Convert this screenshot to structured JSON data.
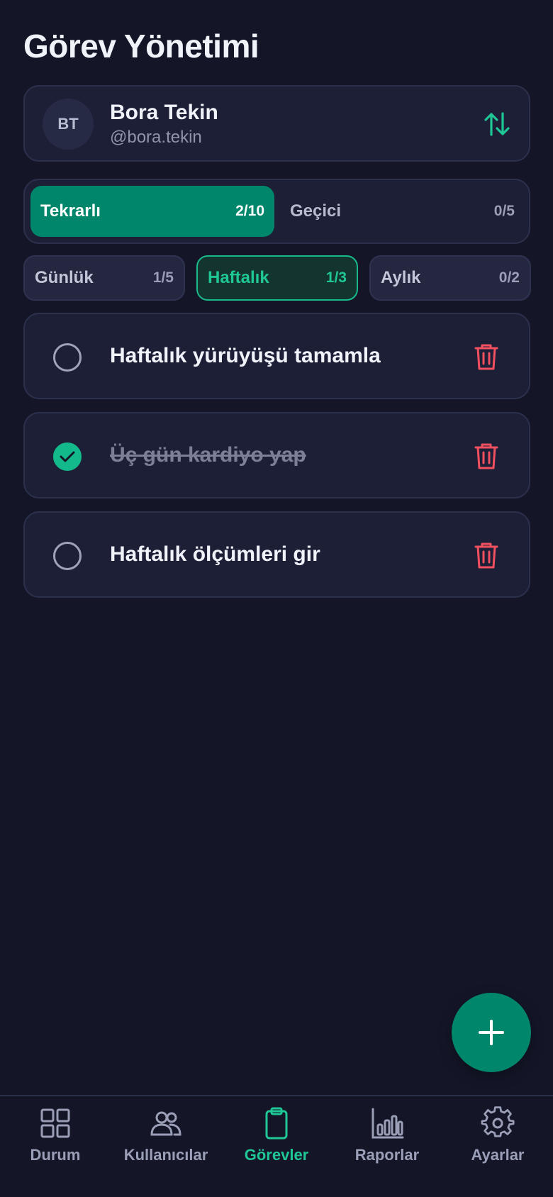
{
  "header": {
    "title": "Görev Yönetimi"
  },
  "user": {
    "initials": "BT",
    "name": "Bora Tekin",
    "handle": "@bora.tekin",
    "swap_icon": "swap-vertical-icon"
  },
  "segments": [
    {
      "label": "Tekrarlı",
      "count": "2/10",
      "active": true
    },
    {
      "label": "Geçici",
      "count": "0/5",
      "active": false
    }
  ],
  "periods": [
    {
      "label": "Günlük",
      "count": "1/5",
      "selected": false
    },
    {
      "label": "Haftalık",
      "count": "1/3",
      "selected": true
    },
    {
      "label": "Aylık",
      "count": "0/2",
      "selected": false
    }
  ],
  "tasks": [
    {
      "text": "Haftalık yürüyüşü tamamla",
      "done": false
    },
    {
      "text": "Üç gün kardiyo yap",
      "done": true
    },
    {
      "text": "Haftalık ölçümleri gir",
      "done": false
    }
  ],
  "fab": {
    "icon": "plus-icon"
  },
  "nav": [
    {
      "label": "Durum",
      "icon": "grid-icon",
      "active": false
    },
    {
      "label": "Kullanıcılar",
      "icon": "users-icon",
      "active": false
    },
    {
      "label": "Görevler",
      "icon": "clipboard-icon",
      "active": true
    },
    {
      "label": "Raporlar",
      "icon": "bar-chart-icon",
      "active": false
    },
    {
      "label": "Ayarlar",
      "icon": "gear-icon",
      "active": false
    }
  ],
  "colors": {
    "accent": "#00876b",
    "accent_text": "#1fc796",
    "danger": "#f0505f",
    "background": "#141628",
    "card": "#1c1f35"
  }
}
